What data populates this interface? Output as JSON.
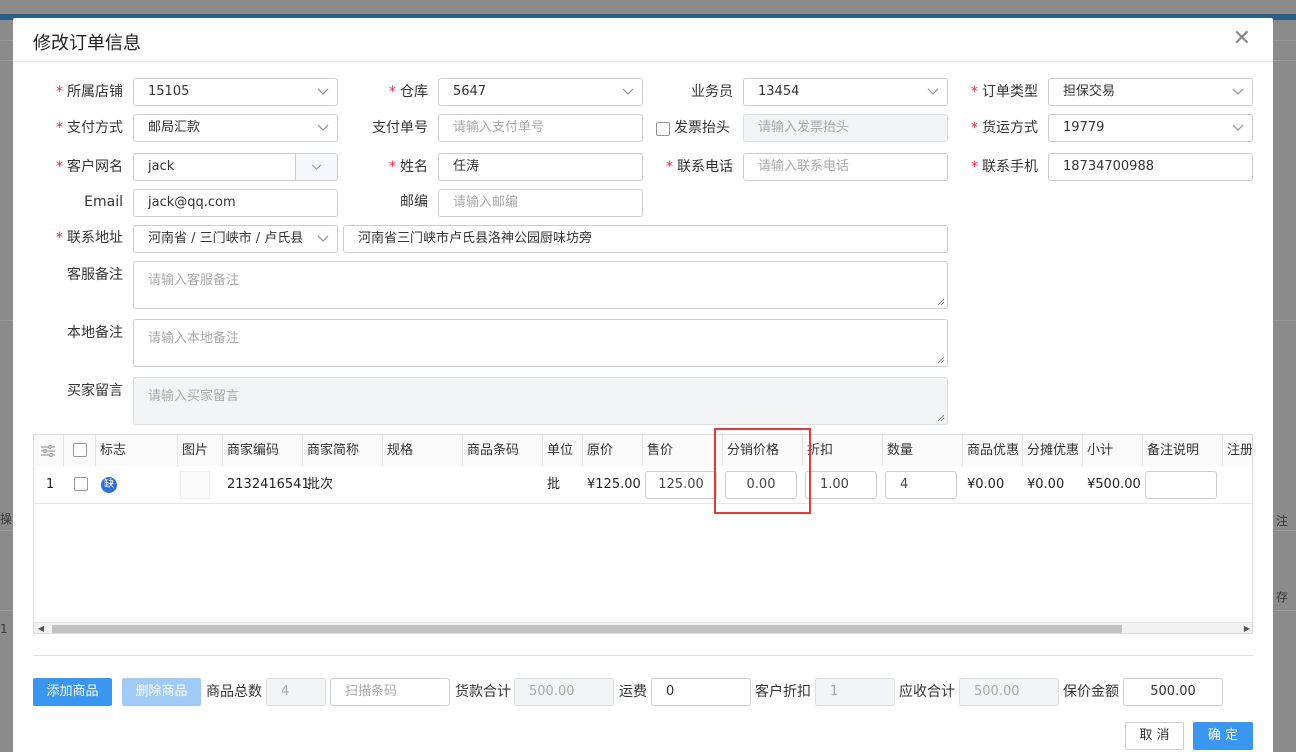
{
  "dialog": {
    "title": "修改订单信息"
  },
  "form": {
    "shop": {
      "label": "所属店铺",
      "value": "15105"
    },
    "warehouse": {
      "label": "仓库",
      "value": "5647"
    },
    "salesman": {
      "label": "业务员",
      "value": "13454"
    },
    "order_type": {
      "label": "订单类型",
      "value": "担保交易"
    },
    "pay_method": {
      "label": "支付方式",
      "value": "邮局汇款"
    },
    "pay_no": {
      "label": "支付单号",
      "placeholder": "请输入支付单号"
    },
    "invoice": {
      "label": "发票抬头",
      "placeholder": "请输入发票抬头"
    },
    "shipping": {
      "label": "货运方式",
      "value": "19779"
    },
    "customer": {
      "label": "客户网名",
      "value": "jack"
    },
    "name": {
      "label": "姓名",
      "value": "任涛"
    },
    "phone": {
      "label": "联系电话",
      "placeholder": "请输入联系电话"
    },
    "mobile": {
      "label": "联系手机",
      "value": "18734700988"
    },
    "email": {
      "label": "Email",
      "value": "jack@qq.com"
    },
    "zip": {
      "label": "邮编",
      "placeholder": "请输入邮编"
    },
    "address": {
      "label": "联系地址",
      "region": "河南省 / 三门峡市 / 卢氏县",
      "detail": "河南省三门峡市卢氏县洛神公园厨味坊旁"
    },
    "cs_note": {
      "label": "客服备注",
      "placeholder": "请输入客服备注"
    },
    "local_note": {
      "label": "本地备注",
      "placeholder": "请输入本地备注"
    },
    "buyer_msg": {
      "label": "买家留言",
      "placeholder": "请输入买家留言"
    }
  },
  "table": {
    "headers": [
      "标志",
      "图片",
      "商家编码",
      "商家简称",
      "规格",
      "商品条码",
      "单位",
      "原价",
      "售价",
      "分销价格",
      "折扣",
      "数量",
      "商品优惠",
      "分摊优惠",
      "小计",
      "备注说明",
      "注册证"
    ],
    "row": {
      "index": "1",
      "badge": "缺",
      "code": "2132416541",
      "short_name": "批次",
      "unit": "批",
      "orig_price": "¥125.00",
      "sale_price": "125.00",
      "dist_price": "0.00",
      "discount": "1.00",
      "qty": "4",
      "goods_discount": "¥0.00",
      "share_discount": "¥0.00",
      "subtotal": "¥500.00"
    }
  },
  "footer": {
    "add_btn": "添加商品",
    "del_btn": "删除商品",
    "total_qty_label": "商品总数",
    "total_qty": "4",
    "scan_placeholder": "扫描条码",
    "goods_total_label": "货款合计",
    "goods_total": "500.00",
    "freight_label": "运费",
    "freight": "0",
    "cust_discount_label": "客户折扣",
    "cust_discount": "1",
    "receivable_label": "应收合计",
    "receivable": "500.00",
    "insured_label": "保价金额",
    "insured": "500.00",
    "cancel": "取 消",
    "confirm": "确 定"
  },
  "background": {
    "left_a": "操",
    "left_b": "1",
    "right_a": "注",
    "right_b": "存"
  },
  "colors": {
    "primary": "#3a96ef",
    "required": "#e24",
    "highlight": "#e63a3a"
  }
}
